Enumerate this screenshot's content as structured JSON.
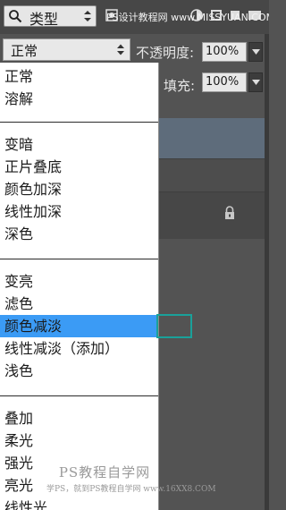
{
  "filter": {
    "type_label": "类型",
    "watermark": "PS设计教程网 www.MISSYUAN.COM"
  },
  "blend": {
    "value": "正常",
    "opacity_label": "不透明度:",
    "opacity_value": "100%",
    "fill_label": "填充:",
    "fill_value": "100%"
  },
  "menu": {
    "groups": [
      [
        "正常",
        "溶解"
      ],
      [
        "变暗",
        "正片叠底",
        "颜色加深",
        "线性加深",
        "深色"
      ],
      [
        "变亮",
        "滤色",
        "颜色减淡",
        "线性减淡（添加）",
        "浅色"
      ],
      [
        "叠加",
        "柔光",
        "强光",
        "亮光",
        "线性光"
      ]
    ],
    "selected": "颜色减淡"
  },
  "watermark_bottom": {
    "line1": "PS教程自学网",
    "line2": "学PS，就到PS教程自学网 www.16XX8.COM"
  },
  "colors": {
    "selected_bg": "#3b9bf5",
    "focus_outline": "#1aa19a",
    "panel_bg": "#535353"
  }
}
